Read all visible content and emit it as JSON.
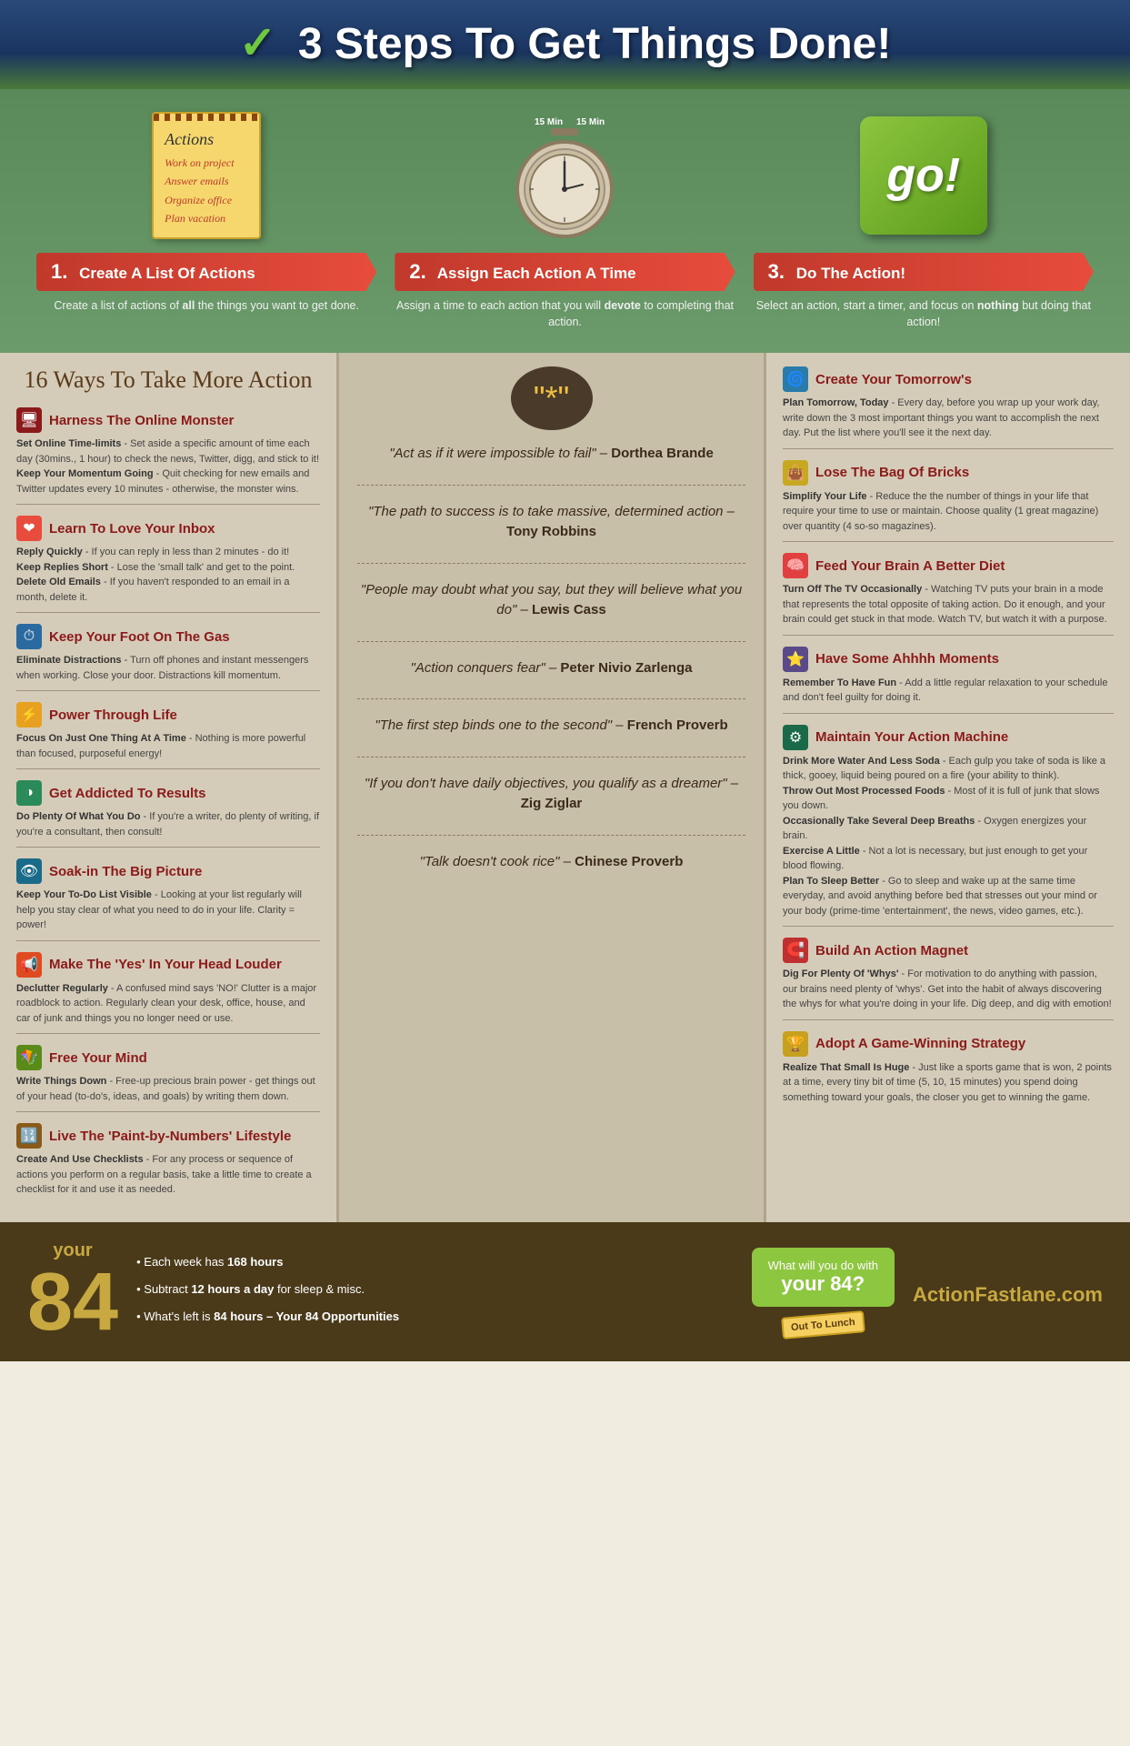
{
  "header": {
    "title": "3 Steps To Get Things Done!",
    "check": "✓"
  },
  "steps": [
    {
      "num": "1.",
      "label": "Create A List Of Actions",
      "desc": "Create a list of actions of all the things you want to get done.",
      "icon_type": "notepad"
    },
    {
      "num": "2.",
      "label": "Assign Each Action A Time",
      "desc": "Assign a time to each action that you will devote to completing that action.",
      "icon_type": "timer"
    },
    {
      "num": "3.",
      "label": "Do The Action!",
      "desc": "Select an action, start a timer, and focus on nothing but doing that action!",
      "icon_type": "go"
    }
  ],
  "notepad": {
    "title": "Actions",
    "lines": [
      "Work on project",
      "Answer emails",
      "Organize office",
      "Plan vacation"
    ]
  },
  "sixteen_ways_title": "16 Ways To Take More Action",
  "left_tips": [
    {
      "id": "harness",
      "icon": "🖥",
      "icon_class": "icon-monitor",
      "title": "Harness The Online Monster",
      "items": [
        {
          "bold": "Set Online Time-limits",
          "text": " - Set aside a specific amount of time each day (30mins., 1 hour) to check the news, Twitter, digg, and stick to it!"
        },
        {
          "bold": "Keep Your Momentum Going",
          "text": " - Quit checking for new emails and Twitter updates every 10 minutes - otherwise, the monster wins."
        }
      ]
    },
    {
      "id": "inbox",
      "icon": "❤",
      "icon_class": "icon-heart",
      "title": "Learn To Love Your Inbox",
      "items": [
        {
          "bold": "Reply Quickly",
          "text": " - If you can reply in less than 2 minutes - do it!"
        },
        {
          "bold": "Keep Replies Short",
          "text": " - Lose the 'small talk' and get to the point."
        },
        {
          "bold": "Delete Old Emails",
          "text": " - If you haven't responded to an email in a month, delete it."
        }
      ]
    },
    {
      "id": "gas",
      "icon": "⏱",
      "icon_class": "icon-clock",
      "title": "Keep Your Foot On The Gas",
      "items": [
        {
          "bold": "Eliminate Distractions",
          "text": " - Turn off phones and instant messengers when working. Close your door. Distractions kill momentum."
        }
      ]
    },
    {
      "id": "power",
      "icon": "⚡",
      "icon_class": "icon-lightning",
      "title": "Power Through Life",
      "items": [
        {
          "bold": "Focus On Just One Thing At A Time",
          "text": " - Nothing is more powerful than focused, purposeful energy!"
        }
      ]
    },
    {
      "id": "addicted",
      "icon": "◑",
      "icon_class": "icon-pie",
      "title": "Get Addicted To Results",
      "items": [
        {
          "bold": "Do Plenty Of What You Do",
          "text": " - If you're a writer, do plenty of writing, if you're a consultant, then consult!"
        }
      ]
    },
    {
      "id": "bigpicture",
      "icon": "👁",
      "icon_class": "icon-eye",
      "title": "Soak-in The Big Picture",
      "items": [
        {
          "bold": "Keep Your To-Do List Visible",
          "text": " - Looking at your list regularly will help you stay clear of what you need to do in your life. Clarity = power!"
        }
      ]
    },
    {
      "id": "yes",
      "icon": "📢",
      "icon_class": "icon-speaker",
      "title": "Make The 'Yes' In Your Head Louder",
      "items": [
        {
          "bold": "Declutter Regularly",
          "text": " - A confused mind says 'NO!' Clutter is a major roadblock to action. Regularly clean your desk, office, house, and car of junk and things you no longer need or use."
        }
      ]
    },
    {
      "id": "mind",
      "icon": "🪁",
      "icon_class": "icon-kite",
      "title": "Free Your Mind",
      "items": [
        {
          "bold": "Write Things Down",
          "text": " - Free-up precious brain power - get things out of your head (to-do's, ideas, and goals) by writing them down."
        }
      ]
    },
    {
      "id": "lifestyle",
      "icon": "🔢",
      "icon_class": "icon-numbers",
      "title": "Live The 'Paint-by-Numbers' Lifestyle",
      "items": [
        {
          "bold": "Create And Use Checklists",
          "text": " - For any process or sequence of actions you perform on a regular basis, take a little time to create a checklist for it and use it as needed."
        }
      ]
    }
  ],
  "quotes": [
    {
      "text": "\"Act as if it were impossible to fail\" – ",
      "author": "Dorthea Brande"
    },
    {
      "text": "\"The path to success is to take massive, determined action – ",
      "author": "Tony Robbins"
    },
    {
      "text": "\"People may doubt what you say, but they will believe what you do\" – ",
      "author": "Lewis Cass"
    },
    {
      "text": "\"Action conquers fear\" – ",
      "author": "Peter Nivio Zarlenga"
    },
    {
      "text": "\"The first step binds one to the second\" – ",
      "author": "French Proverb"
    },
    {
      "text": "\"If you don't have daily objectives, you qualify as a dreamer\" – ",
      "author": "Zig Ziglar"
    },
    {
      "text": "\"Talk doesn't cook rice\" – ",
      "author": "Chinese Proverb"
    }
  ],
  "right_tips": [
    {
      "id": "tomorrows",
      "icon": "🌀",
      "icon_class": "icon-spiral",
      "title": "Create Your Tomorrow's",
      "items": [
        {
          "bold": "Plan Tomorrow, Today",
          "text": " - Every day, before you wrap up your work day, write down the 3 most important things you want to accomplish the next day. Put the list where you'll see it the next day."
        }
      ]
    },
    {
      "id": "bricks",
      "icon": "👜",
      "icon_class": "icon-bag",
      "title": "Lose The Bag Of Bricks",
      "items": [
        {
          "bold": "Simplify Your Life",
          "text": " - Reduce the the number of things in your life that require your time to use or maintain. Choose quality (1 great magazine) over quantity (4 so-so magazines)."
        }
      ]
    },
    {
      "id": "diet",
      "icon": "🧠",
      "icon_class": "icon-brain",
      "title": "Feed Your Brain A Better Diet",
      "items": [
        {
          "bold": "Turn Off The TV Occasionally",
          "text": " - Watching TV puts your brain in a mode that represents the total opposite of taking action. Do it enough, and your brain could get stuck in that mode. Watch TV, but watch it with a purpose."
        }
      ]
    },
    {
      "id": "moments",
      "icon": "⭐",
      "icon_class": "icon-ahh",
      "title": "Have Some Ahhhh Moments",
      "items": [
        {
          "bold": "Remember To Have Fun",
          "text": " - Add a little regular relaxation to your schedule and don't feel guilty for doing it."
        }
      ]
    },
    {
      "id": "machine",
      "icon": "⚙",
      "icon_class": "icon-machine",
      "title": "Maintain Your Action Machine",
      "items": [
        {
          "bold": "Drink More Water And Less Soda",
          "text": " - Each gulp you take of soda is like a thick, gooey, liquid being poured on a fire (your ability to think)."
        },
        {
          "bold": "Throw Out Most Processed Foods",
          "text": " - Most of it is full of junk that slows you down."
        },
        {
          "bold": "Occasionally Take Several Deep Breaths",
          "text": " - Oxygen energizes your brain."
        },
        {
          "bold": "Exercise A Little",
          "text": " - Not a lot is necessary, but just enough to get your blood flowing."
        },
        {
          "bold": "Plan To Sleep Better",
          "text": " - Go to sleep and wake up at the same time everyday, and avoid anything before bed that stresses out your mind or your body (prime-time 'entertainment', the news, video games, etc.)."
        }
      ]
    },
    {
      "id": "magnet",
      "icon": "🧲",
      "icon_class": "icon-magnet",
      "title": "Build An Action Magnet",
      "items": [
        {
          "bold": "Dig For Plenty Of 'Whys'",
          "text": " - For motivation to do anything with passion, our brains need plenty of 'whys'. Get into the habit of always discovering the whys for what you're doing in your life. Dig deep, and dig with emotion!"
        }
      ]
    },
    {
      "id": "strategy",
      "icon": "🏆",
      "icon_class": "icon-trophy",
      "title": "Adopt A Game-Winning Strategy",
      "items": [
        {
          "bold": "Realize That Small Is Huge",
          "text": " - Just like a sports game that is won, 2 points at a time, every tiny bit of time (5, 10, 15 minutes) you spend doing something toward your goals, the closer you get to winning the game."
        }
      ]
    }
  ],
  "footer": {
    "your_label": "your",
    "number": "84",
    "bullets": [
      "Each week has 168 hours",
      "Subtract 12 hours a day for sleep & misc.",
      "What's left is 84 hours – Your 84 Opportunities"
    ],
    "cta_line1": "What will you do with",
    "cta_line2": "your 84?",
    "sign": "Out To Lunch",
    "domain": "ActionFastlane.com"
  }
}
